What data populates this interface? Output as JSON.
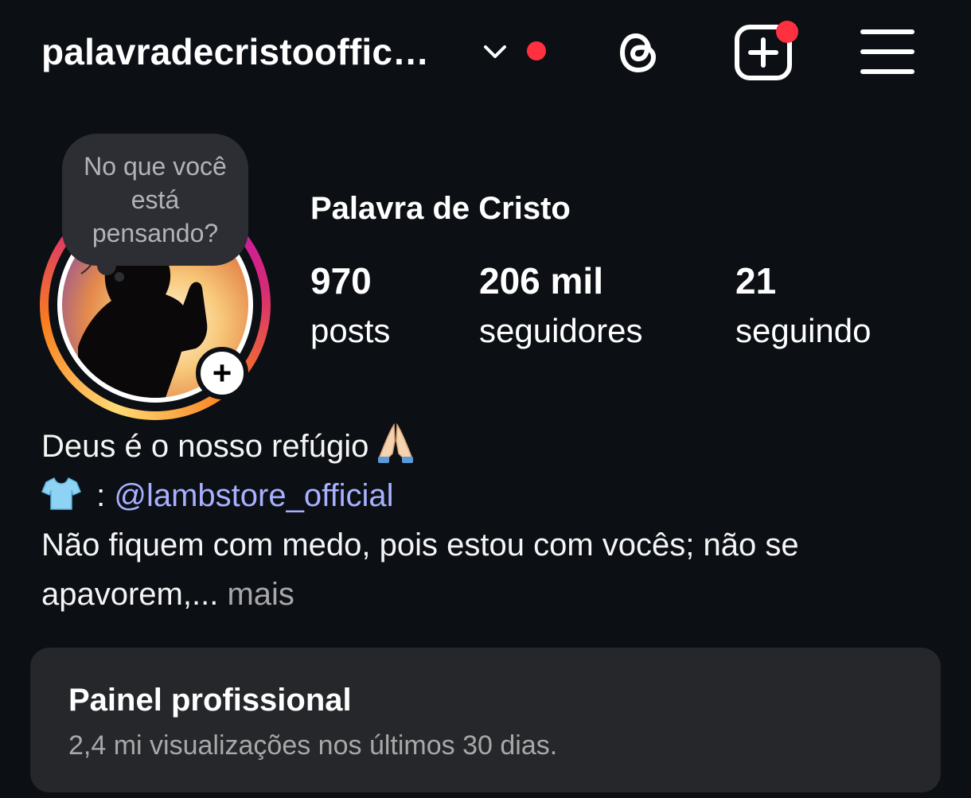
{
  "header": {
    "username": "palavradecristooffic…",
    "icons": {
      "account_switch": "chevron-down-icon",
      "threads": "threads-icon",
      "create": "add-square-icon",
      "menu": "hamburger-menu-icon"
    },
    "colors": {
      "notification_dot": "#ff3040"
    }
  },
  "note": {
    "placeholder": "No que você está pensando?"
  },
  "profile": {
    "display_name": "Palavra de Cristo",
    "stats": [
      {
        "value": "970",
        "label": "posts"
      },
      {
        "value": "206 mil",
        "label": "seguidores"
      },
      {
        "value": "21",
        "label": "seguindo"
      }
    ]
  },
  "bio": {
    "line1": "Deus é o nosso refúgio",
    "line1_emoji": "folded-hands-icon",
    "line2_emoji": "t-shirt-icon",
    "line2_sep": " : ",
    "line2_link": "@lambstore_official",
    "line3": "Não fiquem com medo, pois estou com vocês; não se",
    "line4": "apavorem,...",
    "more": " mais",
    "colors": {
      "link": "#a8b1ff",
      "more": "#a8a8a8"
    }
  },
  "professional_dashboard": {
    "title": "Painel profissional",
    "subtitle": "2,4 mi visualizações nos últimos 30 dias."
  }
}
